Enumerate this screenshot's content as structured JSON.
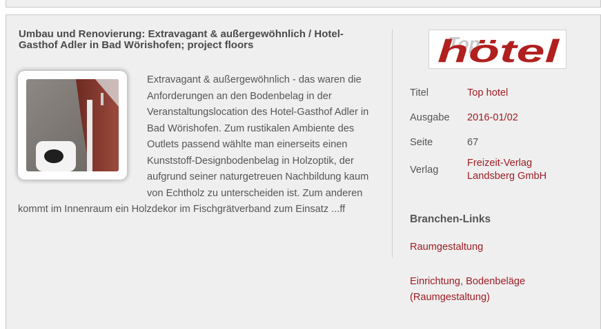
{
  "article": {
    "title": "Umbau und Renovierung: Extravagant & außergewöhnlich / Hotel-Gasthof Adler in Bad Wörishofen; project floors",
    "teaser": "Extravagant & außergewöhnlich - das waren die Anforderungen an den Bodenbelag in der Veranstaltungslocation des Hotel-Gasthof Adler in Bad Wörishofen. Zum rustikalen Ambiente des Outlets passend wählte man einerseits einen Kunststoff-Designbodenbelag in Holzoptik, der aufgrund seiner naturgetreuen Nachbildung kaum von Echtholz zu unterscheiden ist. Zum anderen kommt im Innenraum ein Holzdekor im Fischgrätverband zum Einsatz ...ff"
  },
  "publication": {
    "logo_text_small": "Top",
    "logo_text": "hötel",
    "fields": [
      {
        "key": "Titel",
        "value": "Top hotel"
      },
      {
        "key": "Ausgabe",
        "value": "2016-01/02"
      },
      {
        "key": "Seite",
        "value": "67"
      },
      {
        "key": "Verlag",
        "value": "Freizeit-Verlag Landsberg GmbH"
      }
    ]
  },
  "branchen": {
    "title": "Branchen-Links",
    "link1": "Raumgestaltung",
    "link2a": "Einrichtung",
    "separator": ", ",
    "link2b": "Bodenbeläge (Raumgestaltung)"
  },
  "colors": {
    "link": "#9e1c24",
    "logo": "#b0201f",
    "panel_bg": "#efefef"
  }
}
